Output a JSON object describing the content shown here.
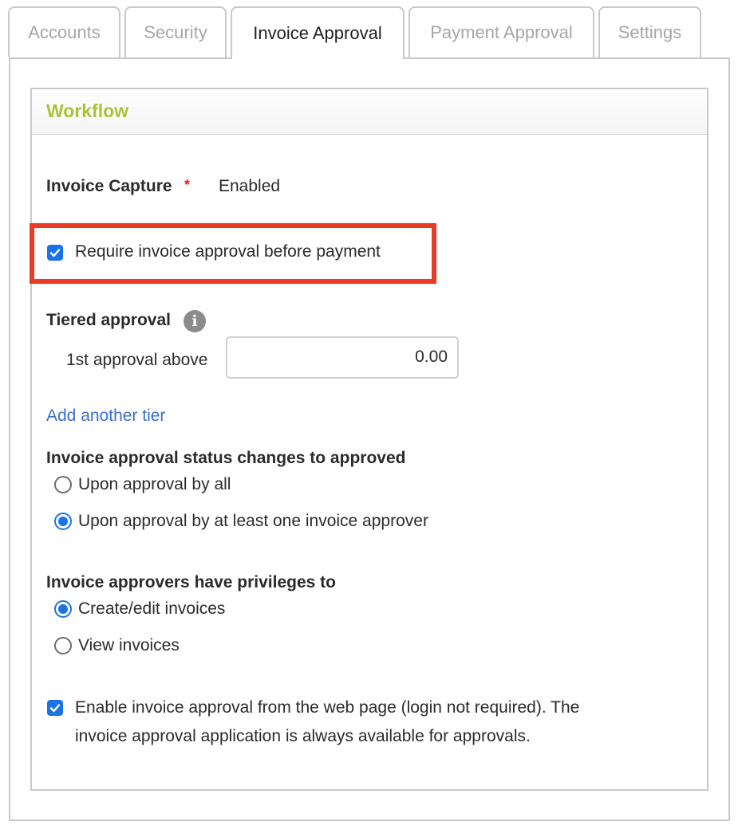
{
  "tabs": [
    {
      "label": "Accounts"
    },
    {
      "label": "Security"
    },
    {
      "label": "Invoice Approval"
    },
    {
      "label": "Payment Approval"
    },
    {
      "label": "Settings"
    }
  ],
  "workflow": {
    "title": "Workflow",
    "invoice_capture": {
      "label": "Invoice Capture",
      "required_mark": "*",
      "value": "Enabled"
    },
    "require_approval": {
      "label": "Require invoice approval before payment",
      "checked": true
    },
    "tiered_approval": {
      "label": "Tiered approval",
      "info_icon": "i",
      "tier1_label": "1st approval above",
      "tier1_value": "0.00",
      "add_tier_link": "Add another tier"
    },
    "status_changes": {
      "heading": "Invoice approval status changes to approved",
      "options": [
        {
          "label": "Upon approval by all",
          "selected": false
        },
        {
          "label": "Upon approval by at least one invoice approver",
          "selected": true
        }
      ]
    },
    "privileges": {
      "heading": "Invoice approvers have privileges to",
      "options": [
        {
          "label": "Create/edit invoices",
          "selected": true
        },
        {
          "label": "View invoices",
          "selected": false
        }
      ]
    },
    "web_approval": {
      "line1": "Enable invoice approval from the web page (login not required). The",
      "line2": "invoice approval application is always available for approvals.",
      "checked": true
    }
  },
  "colors": {
    "accent": "#1a73e8",
    "title": "#a9c23a",
    "highlight": "#ec3b25",
    "link": "#3b6fc9"
  }
}
